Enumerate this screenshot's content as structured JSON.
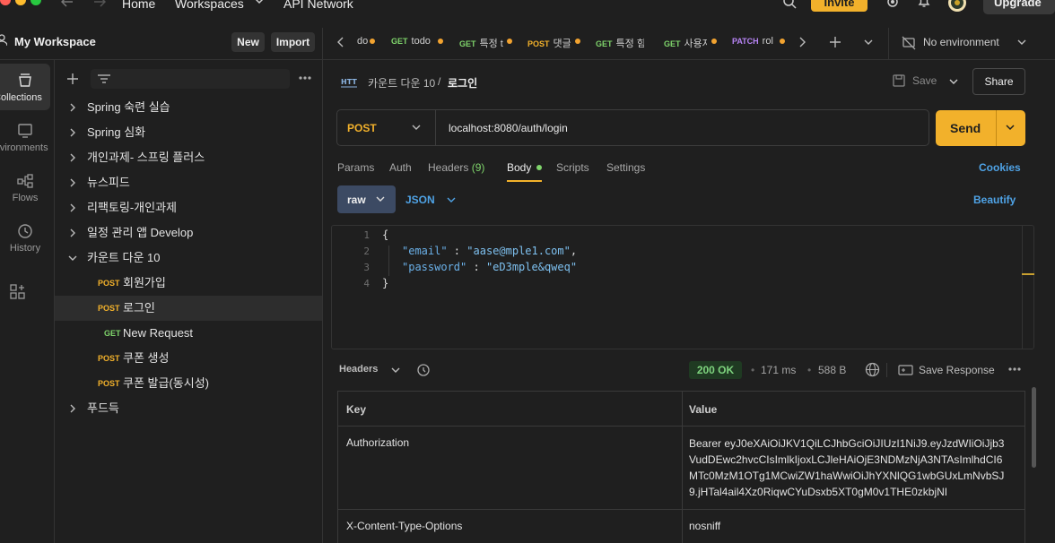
{
  "topbar": {
    "nav": [
      "Home",
      "Workspaces",
      "API Network"
    ],
    "invite_label": "Invite",
    "upgrade_label": "Upgrade"
  },
  "workspace": {
    "title": "My Workspace",
    "new_label": "New",
    "import_label": "Import"
  },
  "rail": {
    "items": [
      {
        "label": "Collections",
        "icon": "collections-icon"
      },
      {
        "label": "Environments",
        "icon": "environments-icon"
      },
      {
        "label": "Flows",
        "icon": "flows-icon"
      },
      {
        "label": "History",
        "icon": "history-icon"
      }
    ]
  },
  "tree": {
    "collections": [
      "Spring 숙련 실습",
      "Spring 심화",
      "개인과제- 스프링 플러스",
      "뉴스피드",
      "리팩토링-개인과제",
      "일정 관리 앱 Develop",
      "카운트 다운 10"
    ],
    "requests": [
      {
        "method": "POST",
        "label": "회원가입"
      },
      {
        "method": "POST",
        "label": "로그인"
      },
      {
        "method": "GET",
        "label": "New Request"
      },
      {
        "method": "POST",
        "label": "쿠폰 생성"
      },
      {
        "method": "POST",
        "label": "쿠폰 발급(동시성)"
      }
    ],
    "last_collection": "푸드득"
  },
  "tabs": [
    {
      "method": "",
      "label": "do"
    },
    {
      "method": "GET",
      "label": "todo"
    },
    {
      "method": "GET",
      "label": "특정 t"
    },
    {
      "method": "POST",
      "label": "댓글"
    },
    {
      "method": "GET",
      "label": "특정 힘"
    },
    {
      "method": "GET",
      "label": "사용자"
    },
    {
      "method": "PATCH",
      "label": "rol"
    }
  ],
  "environment": "No environment",
  "request": {
    "breadcrumb_parent": "카운트 다운 10",
    "breadcrumb_sep": "/",
    "breadcrumb_current": "로그인",
    "save_label": "Save",
    "share_label": "Share",
    "method": "POST",
    "url": "localhost:8080/auth/login",
    "send_label": "Send",
    "subtabs": [
      "Params",
      "Auth",
      "Headers",
      "Body",
      "Scripts",
      "Settings"
    ],
    "headers_count": "(9)",
    "cookies_label": "Cookies",
    "body_mode": "raw",
    "body_format": "JSON",
    "beautify_label": "Beautify"
  },
  "body_code": {
    "line_numbers": [
      "1",
      "2",
      "3",
      "4"
    ],
    "open": "{",
    "close": "}",
    "fields": [
      {
        "key": "\"email\"",
        "sep": " : ",
        "value": "\"aase@mple1.com\"",
        "trail": ","
      },
      {
        "key": "\"password\"",
        "sep": " : ",
        "value": "\"eD3mple&qweq\"",
        "trail": ""
      }
    ]
  },
  "response": {
    "section_label": "Headers",
    "status": "200 OK",
    "time": "171 ms",
    "size": "588 B",
    "save_response_label": "Save Response",
    "col_key": "Key",
    "col_value": "Value",
    "rows": [
      {
        "key": "Authorization",
        "value_lines": [
          "Bearer eyJ0eXAiOiJKV1QiLCJhbGciOiJIUzI1NiJ9.eyJzdWIiOiJjb3",
          "VudDEwc2hvcCIsImlkIjoxLCJleHAiOjE3NDMzNjA3NTAsImlhdCI6",
          "MTc0MzM1OTg1MCwiZW1haWwiOiJhYXNlQG1wbGUxLmNvbSJ",
          "9.jHTal4ail4Xz0RiqwCYuDsxb5XT0gM0v1THE0zkbjNI"
        ]
      },
      {
        "key": "X-Content-Type-Options",
        "value_lines": [
          "nosniff"
        ]
      }
    ]
  },
  "colors": {
    "accent": "#f2b12b",
    "get": "#7fd46b",
    "patch": "#b784f5",
    "link": "#4fa3e6"
  }
}
